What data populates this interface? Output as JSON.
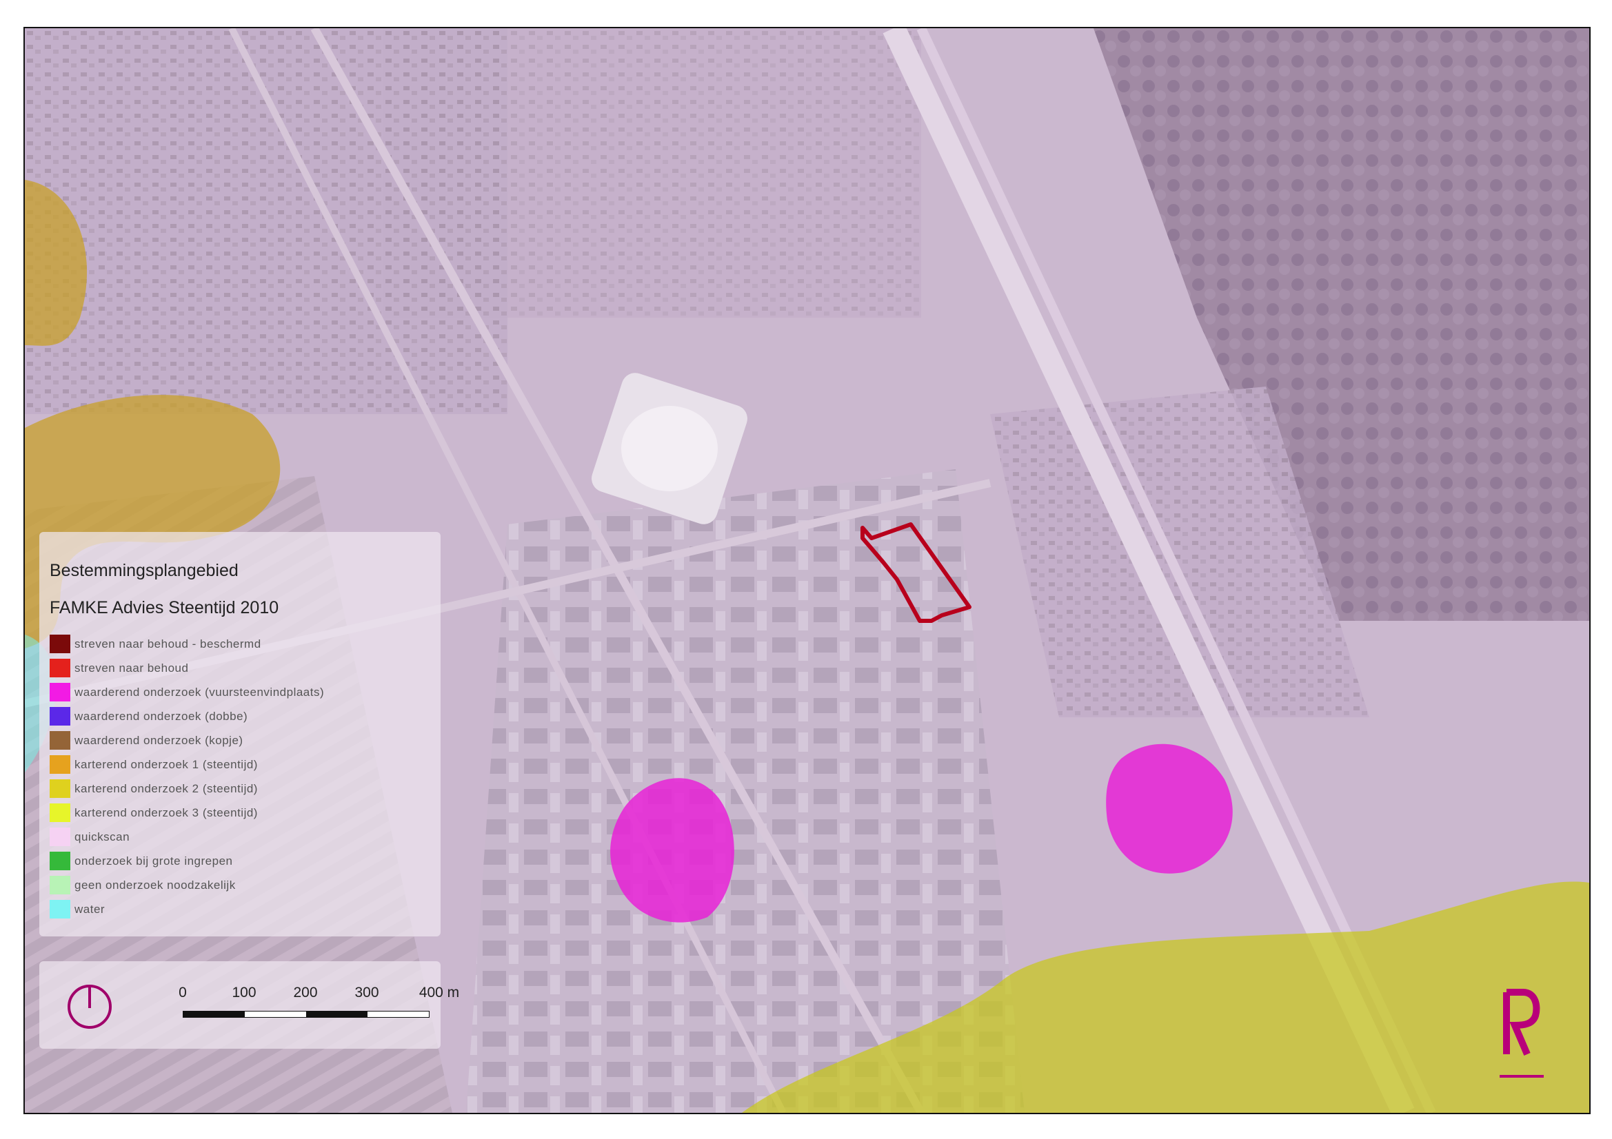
{
  "legend": {
    "title": "Bestemmingsplangebied",
    "subtitle": "FAMKE Advies Steentijd 2010",
    "items": [
      {
        "label": "streven naar behoud - beschermd",
        "color": "#7b0a0a"
      },
      {
        "label": "streven naar behoud",
        "color": "#e4211c"
      },
      {
        "label": "waarderend onderzoek (vuursteenvindplaats)",
        "color": "#f21be4"
      },
      {
        "label": "waarderend onderzoek (dobbe)",
        "color": "#5b28e8"
      },
      {
        "label": "waarderend onderzoek (kopje)",
        "color": "#946437"
      },
      {
        "label": "karterend onderzoek 1 (steentijd)",
        "color": "#e6a21e"
      },
      {
        "label": "karterend onderzoek 2 (steentijd)",
        "color": "#dfd11e"
      },
      {
        "label": "karterend onderzoek 3 (steentijd)",
        "color": "#e7f52a"
      },
      {
        "label": "quickscan",
        "color": "#f6d2f3"
      },
      {
        "label": "onderzoek bij grote ingrepen",
        "color": "#35b93a"
      },
      {
        "label": "geen onderzoek noodzakelijk",
        "color": "#b8f3b6"
      },
      {
        "label": "water",
        "color": "#7ef3f3"
      }
    ]
  },
  "scale_bar": {
    "ticks": [
      "0",
      "100",
      "200",
      "300",
      "400 m"
    ]
  },
  "north_arrow": {
    "icon": "north-arrow-icon",
    "color": "#a0006a"
  },
  "brand_logo": {
    "text": "R",
    "color": "#b8007a"
  },
  "map": {
    "plan_area_outline_color": "#b8001c",
    "base_tint": "#cdb9d3"
  }
}
